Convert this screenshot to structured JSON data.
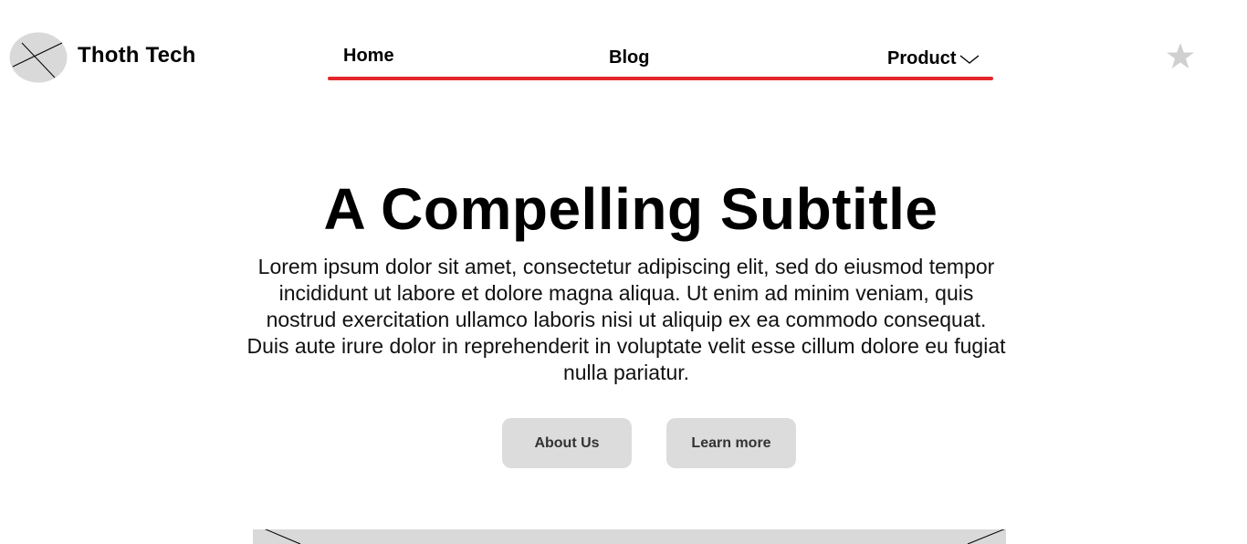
{
  "brand": {
    "name": "Thoth Tech",
    "logo_icon": "image-placeholder-icon"
  },
  "nav": {
    "items": [
      {
        "label": "Home"
      },
      {
        "label": "Blog"
      },
      {
        "label": "Product",
        "icon": "chevron-down-icon"
      }
    ],
    "active_underline_color": "#e3262a"
  },
  "header_actions": {
    "star_icon": "star-icon"
  },
  "hero": {
    "title": "A Compelling Subtitle",
    "body": "Lorem ipsum dolor sit amet, consectetur adipiscing elit, sed do eiusmod tempor incididunt ut labore et dolore magna aliqua. Ut enim ad minim veniam, quis nostrud exercitation ullamco laboris nisi ut aliquip ex ea commodo consequat. Duis aute irure dolor in reprehenderit in voluptate velit esse cillum dolore eu fugiat nulla pariatur.",
    "buttons": [
      {
        "label": "About Us"
      },
      {
        "label": "Learn more"
      }
    ]
  },
  "colors": {
    "placeholder": "#d9d9d9",
    "button_bg": "#dcdcdc"
  }
}
